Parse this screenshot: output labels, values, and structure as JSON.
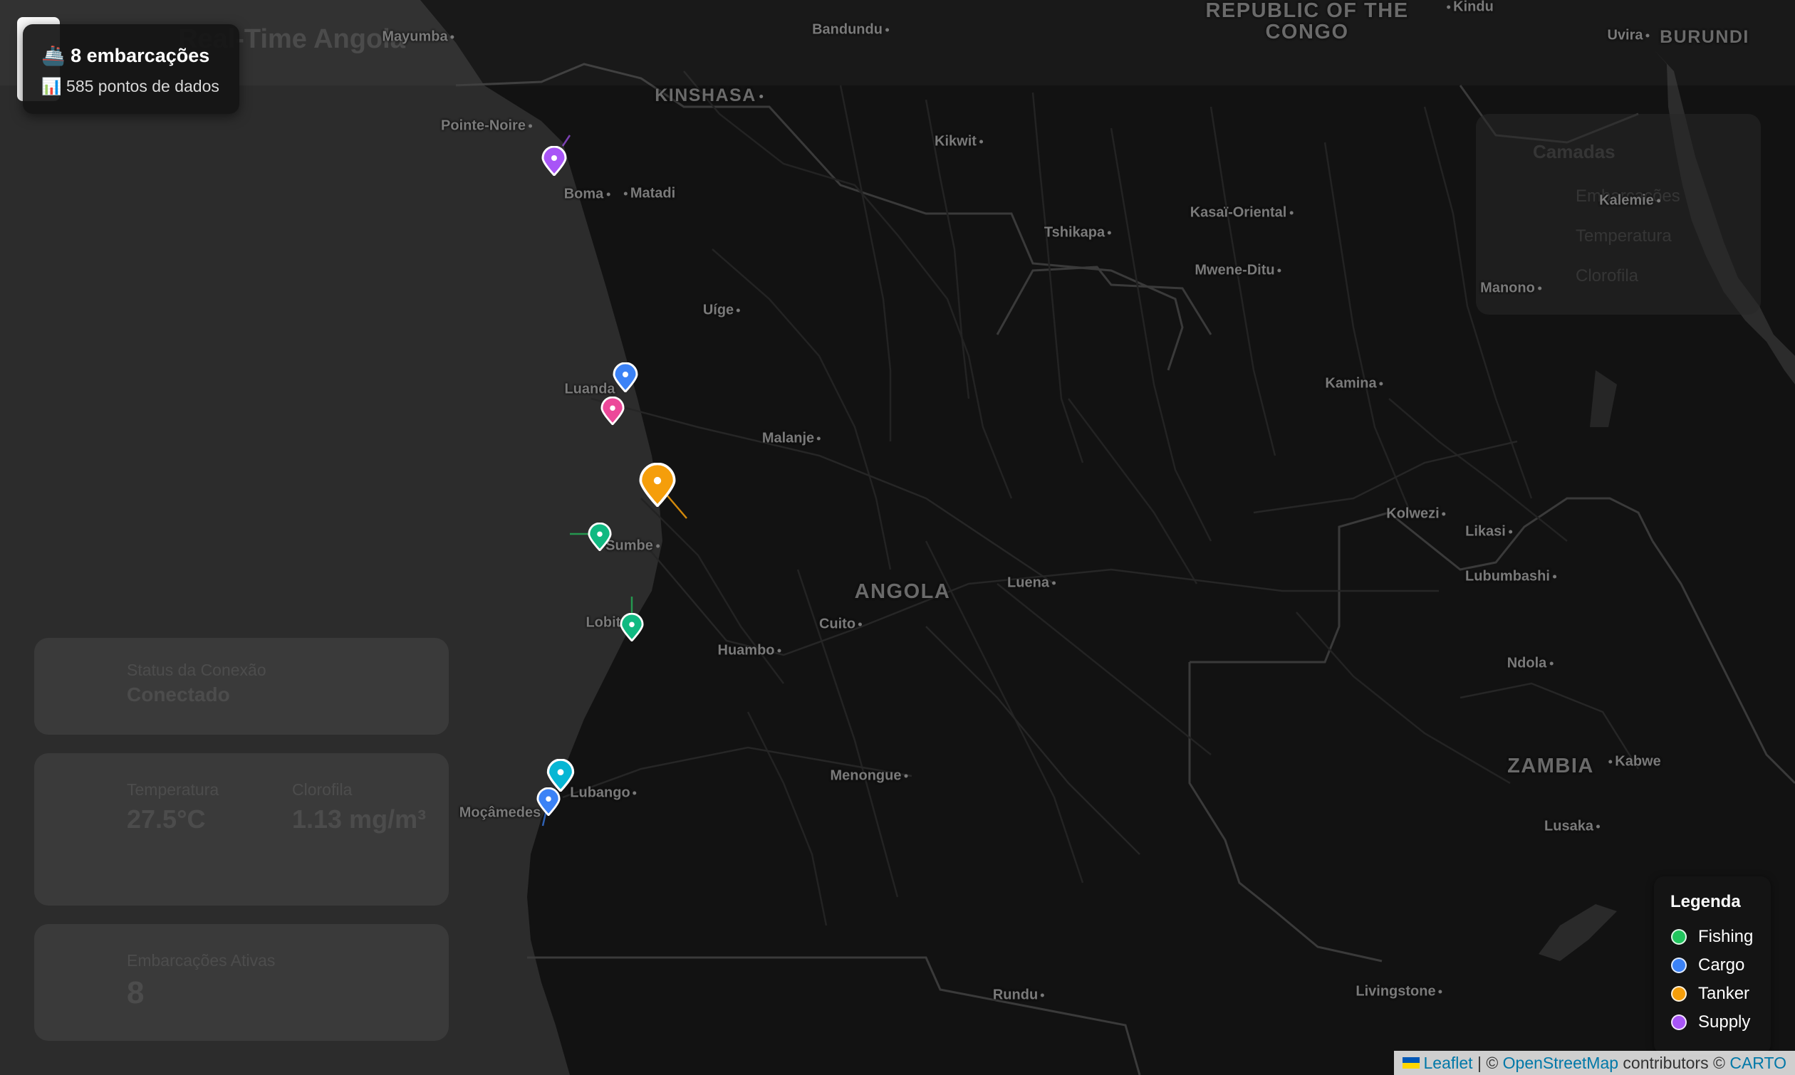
{
  "header": {
    "title": "Real-Time Angola"
  },
  "stats": {
    "vessels_icon": "ship-icon",
    "vessels_text": "🚢 8 embarcações",
    "points_icon": "bar-chart-icon",
    "points_text": "📊 585 pontos de dados"
  },
  "layers_panel": {
    "title": "Camadas",
    "items": [
      "Embarcações",
      "Temperatura",
      "Clorofila"
    ]
  },
  "cards": {
    "connection": {
      "label": "Status da Conexão",
      "value": "Conectado"
    },
    "temperature": {
      "label": "Temperatura",
      "value": "27.5°C"
    },
    "chlorophyll": {
      "label": "Clorofila",
      "value": "1.13 mg/m³"
    },
    "vessels": {
      "label": "Embarcações Ativas",
      "value": "8"
    }
  },
  "legend": {
    "title": "Legenda",
    "items": [
      {
        "label": "Fishing",
        "color": "#22c55e"
      },
      {
        "label": "Cargo",
        "color": "#3b82f6"
      },
      {
        "label": "Tanker",
        "color": "#f59e0b"
      },
      {
        "label": "Supply",
        "color": "#a855f7"
      }
    ]
  },
  "attribution": {
    "leaflet": "Leaflet",
    "sep1": " | © ",
    "osm": "OpenStreetMap",
    "contributors": " contributors © ",
    "carto": "CARTO"
  },
  "map_labels": {
    "countries": [
      "REPUBLIC OF THE",
      "CONGO",
      "ANGOLA",
      "ZAMBIA",
      "BURUNDI",
      "KINSHASA"
    ],
    "cities": [
      "Mayumba",
      "Bandundu",
      "Kindu",
      "Uvira",
      "Pointe-Noire",
      "Boma",
      "Matadi",
      "Kikwit",
      "Kalemie",
      "Tshikapa",
      "Kasaï-Oriental",
      "Mwene-Ditu",
      "Manono",
      "Uíge",
      "Luanda",
      "Malanje",
      "Kamina",
      "Kolwezi",
      "Likasi",
      "Lubumbashi",
      "Sumbe",
      "Luena",
      "Lobito",
      "Cuito",
      "Huambo",
      "Ndola",
      "Kabwe",
      "Lusaka",
      "Lubango",
      "Moçâmedes",
      "Menongue",
      "Rundu",
      "Livingstone"
    ]
  },
  "vessel_colors": {
    "fishing": "#22c55e",
    "cargo": "#3b82f6",
    "tanker": "#f59e0b",
    "supply": "#a855f7",
    "pink": "#ec4899",
    "cyan": "#06b6d4"
  }
}
